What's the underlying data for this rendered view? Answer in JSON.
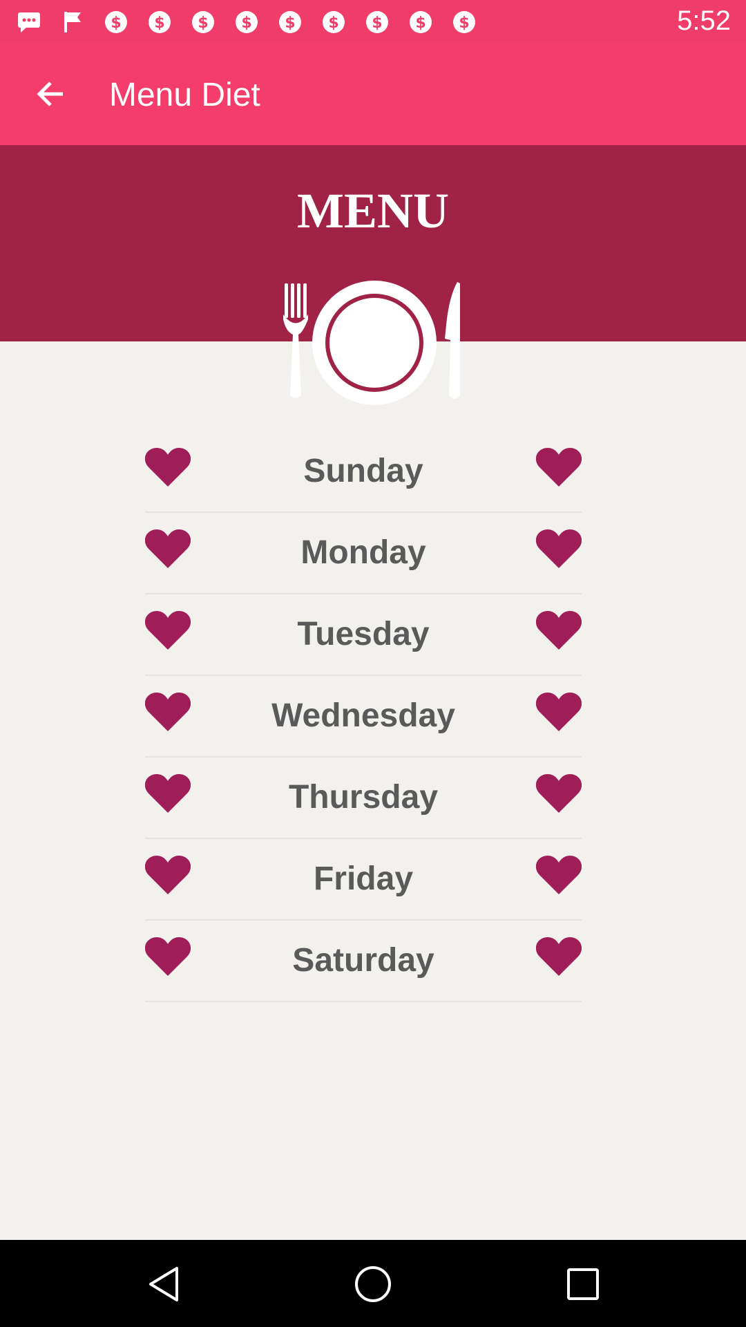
{
  "status_bar": {
    "time": "5:52",
    "icons": [
      "chat-icon",
      "flag-icon",
      "dollar-icon",
      "dollar-icon",
      "dollar-icon",
      "dollar-icon",
      "dollar-icon",
      "dollar-icon",
      "dollar-icon",
      "dollar-icon",
      "dollar-icon",
      "dollar-icon"
    ]
  },
  "app_bar": {
    "title": "Menu Diet",
    "back_icon": "arrow-back-icon"
  },
  "header": {
    "heading": "MENU",
    "graphic": "plate-fork-knife-icon"
  },
  "days": [
    {
      "label": "Sunday"
    },
    {
      "label": "Monday"
    },
    {
      "label": "Tuesday"
    },
    {
      "label": "Wednesday"
    },
    {
      "label": "Thursday"
    },
    {
      "label": "Friday"
    },
    {
      "label": "Saturday"
    }
  ],
  "colors": {
    "status_bar": "#f03c69",
    "app_bar": "#f53d6b",
    "header_band": "#a02247",
    "heart": "#a01e58",
    "background": "#f3f1ee"
  },
  "nav_bar": {
    "back": "nav-back-icon",
    "home": "nav-home-icon",
    "recents": "nav-recents-icon"
  }
}
